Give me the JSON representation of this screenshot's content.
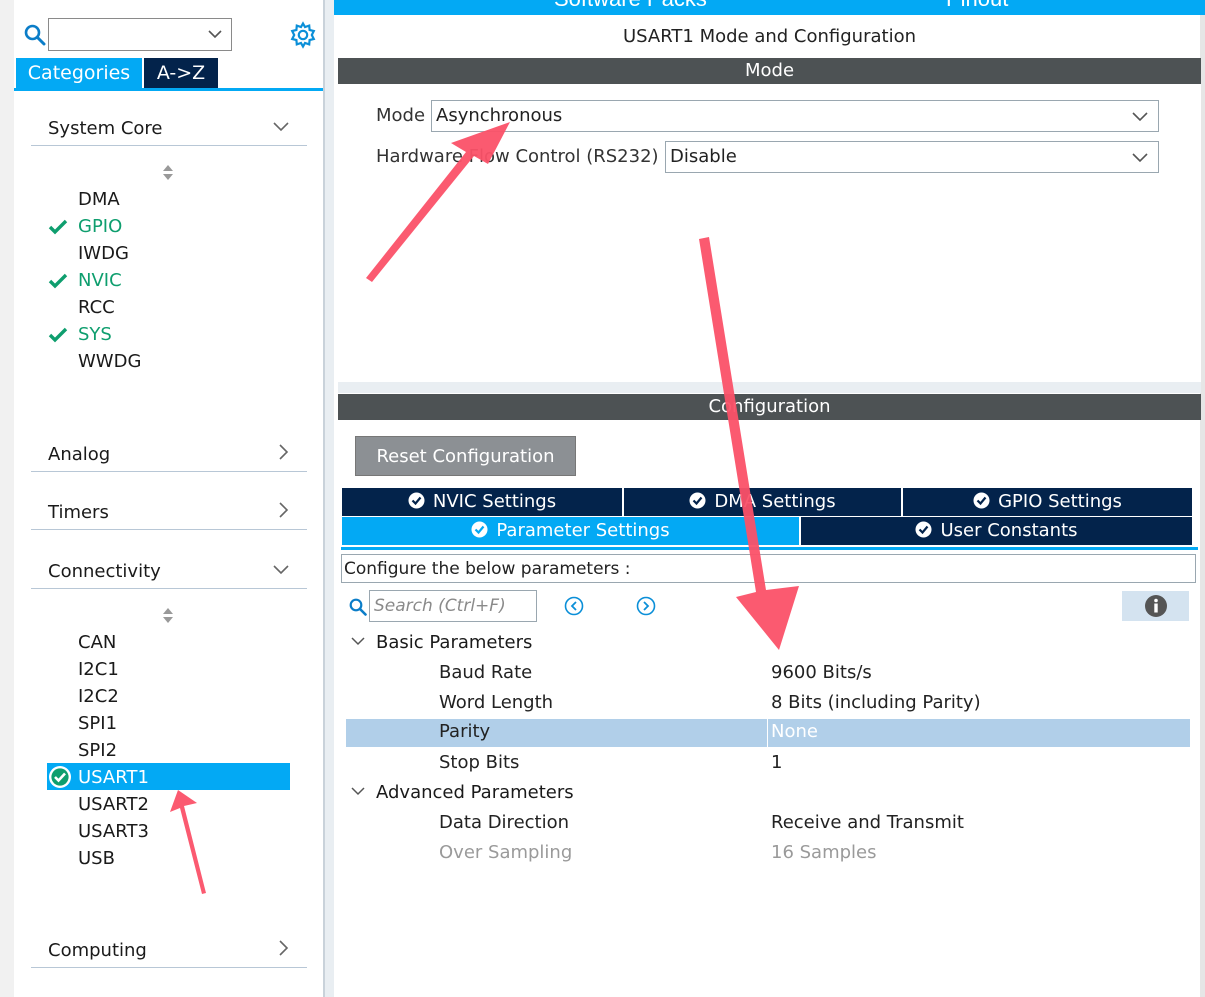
{
  "top_bar": {
    "left_label": "Software Packs",
    "right_label": "Pinout"
  },
  "left_panel": {
    "search": {
      "placeholder": ""
    },
    "tabs": [
      {
        "label": "Categories"
      },
      {
        "label": "A->Z"
      }
    ],
    "sections": {
      "system_core": {
        "label": "System Core",
        "items": [
          {
            "label": "DMA",
            "enabled": false
          },
          {
            "label": "GPIO",
            "enabled": true
          },
          {
            "label": "IWDG",
            "enabled": false
          },
          {
            "label": "NVIC",
            "enabled": true
          },
          {
            "label": "RCC",
            "enabled": false
          },
          {
            "label": "SYS",
            "enabled": true
          },
          {
            "label": "WWDG",
            "enabled": false
          }
        ]
      },
      "analog": {
        "label": "Analog"
      },
      "timers": {
        "label": "Timers"
      },
      "connectivity": {
        "label": "Connectivity",
        "items": [
          {
            "label": "CAN",
            "enabled": false
          },
          {
            "label": "I2C1",
            "enabled": false
          },
          {
            "label": "I2C2",
            "enabled": false
          },
          {
            "label": "SPI1",
            "enabled": false
          },
          {
            "label": "SPI2",
            "enabled": false
          },
          {
            "label": "USART1",
            "enabled": true,
            "selected": true
          },
          {
            "label": "USART2",
            "enabled": false
          },
          {
            "label": "USART3",
            "enabled": false
          },
          {
            "label": "USB",
            "enabled": false
          }
        ]
      },
      "computing": {
        "label": "Computing"
      }
    }
  },
  "right_panel": {
    "title": "USART1 Mode and Configuration",
    "mode_header": "Mode",
    "mode": {
      "label": "Mode",
      "value": "Asynchronous"
    },
    "flow_control": {
      "label": "Hardware Flow Control (RS232)",
      "value": "Disable"
    },
    "configuration_header": "Configuration",
    "reset_button": "Reset Configuration",
    "tabs": {
      "nvic": "NVIC Settings",
      "dma": "DMA Settings",
      "gpio": "GPIO Settings",
      "parameter": "Parameter Settings",
      "user_constants": "User Constants"
    },
    "config_description": "Configure the below parameters :",
    "search_placeholder": "Search (Ctrl+F)",
    "groups": {
      "basic": {
        "label": "Basic Parameters",
        "params": [
          {
            "name": "Baud Rate",
            "value": "9600 Bits/s"
          },
          {
            "name": "Word Length",
            "value": "8 Bits (including Parity)"
          },
          {
            "name": "Parity",
            "value": "None"
          },
          {
            "name": "Stop Bits",
            "value": "1"
          }
        ]
      },
      "advanced": {
        "label": "Advanced Parameters",
        "params": [
          {
            "name": "Data Direction",
            "value": "Receive and Transmit"
          },
          {
            "name": "Over Sampling",
            "value": "16 Samples"
          }
        ]
      }
    }
  },
  "colors": {
    "accent": "#03a9f4",
    "navy": "#03234b",
    "enabled_text": "#0e9e6e",
    "annotation_arrow": "#fb4f66",
    "selected_row": "#b1cfe9",
    "header_bar": "#4d5254"
  }
}
